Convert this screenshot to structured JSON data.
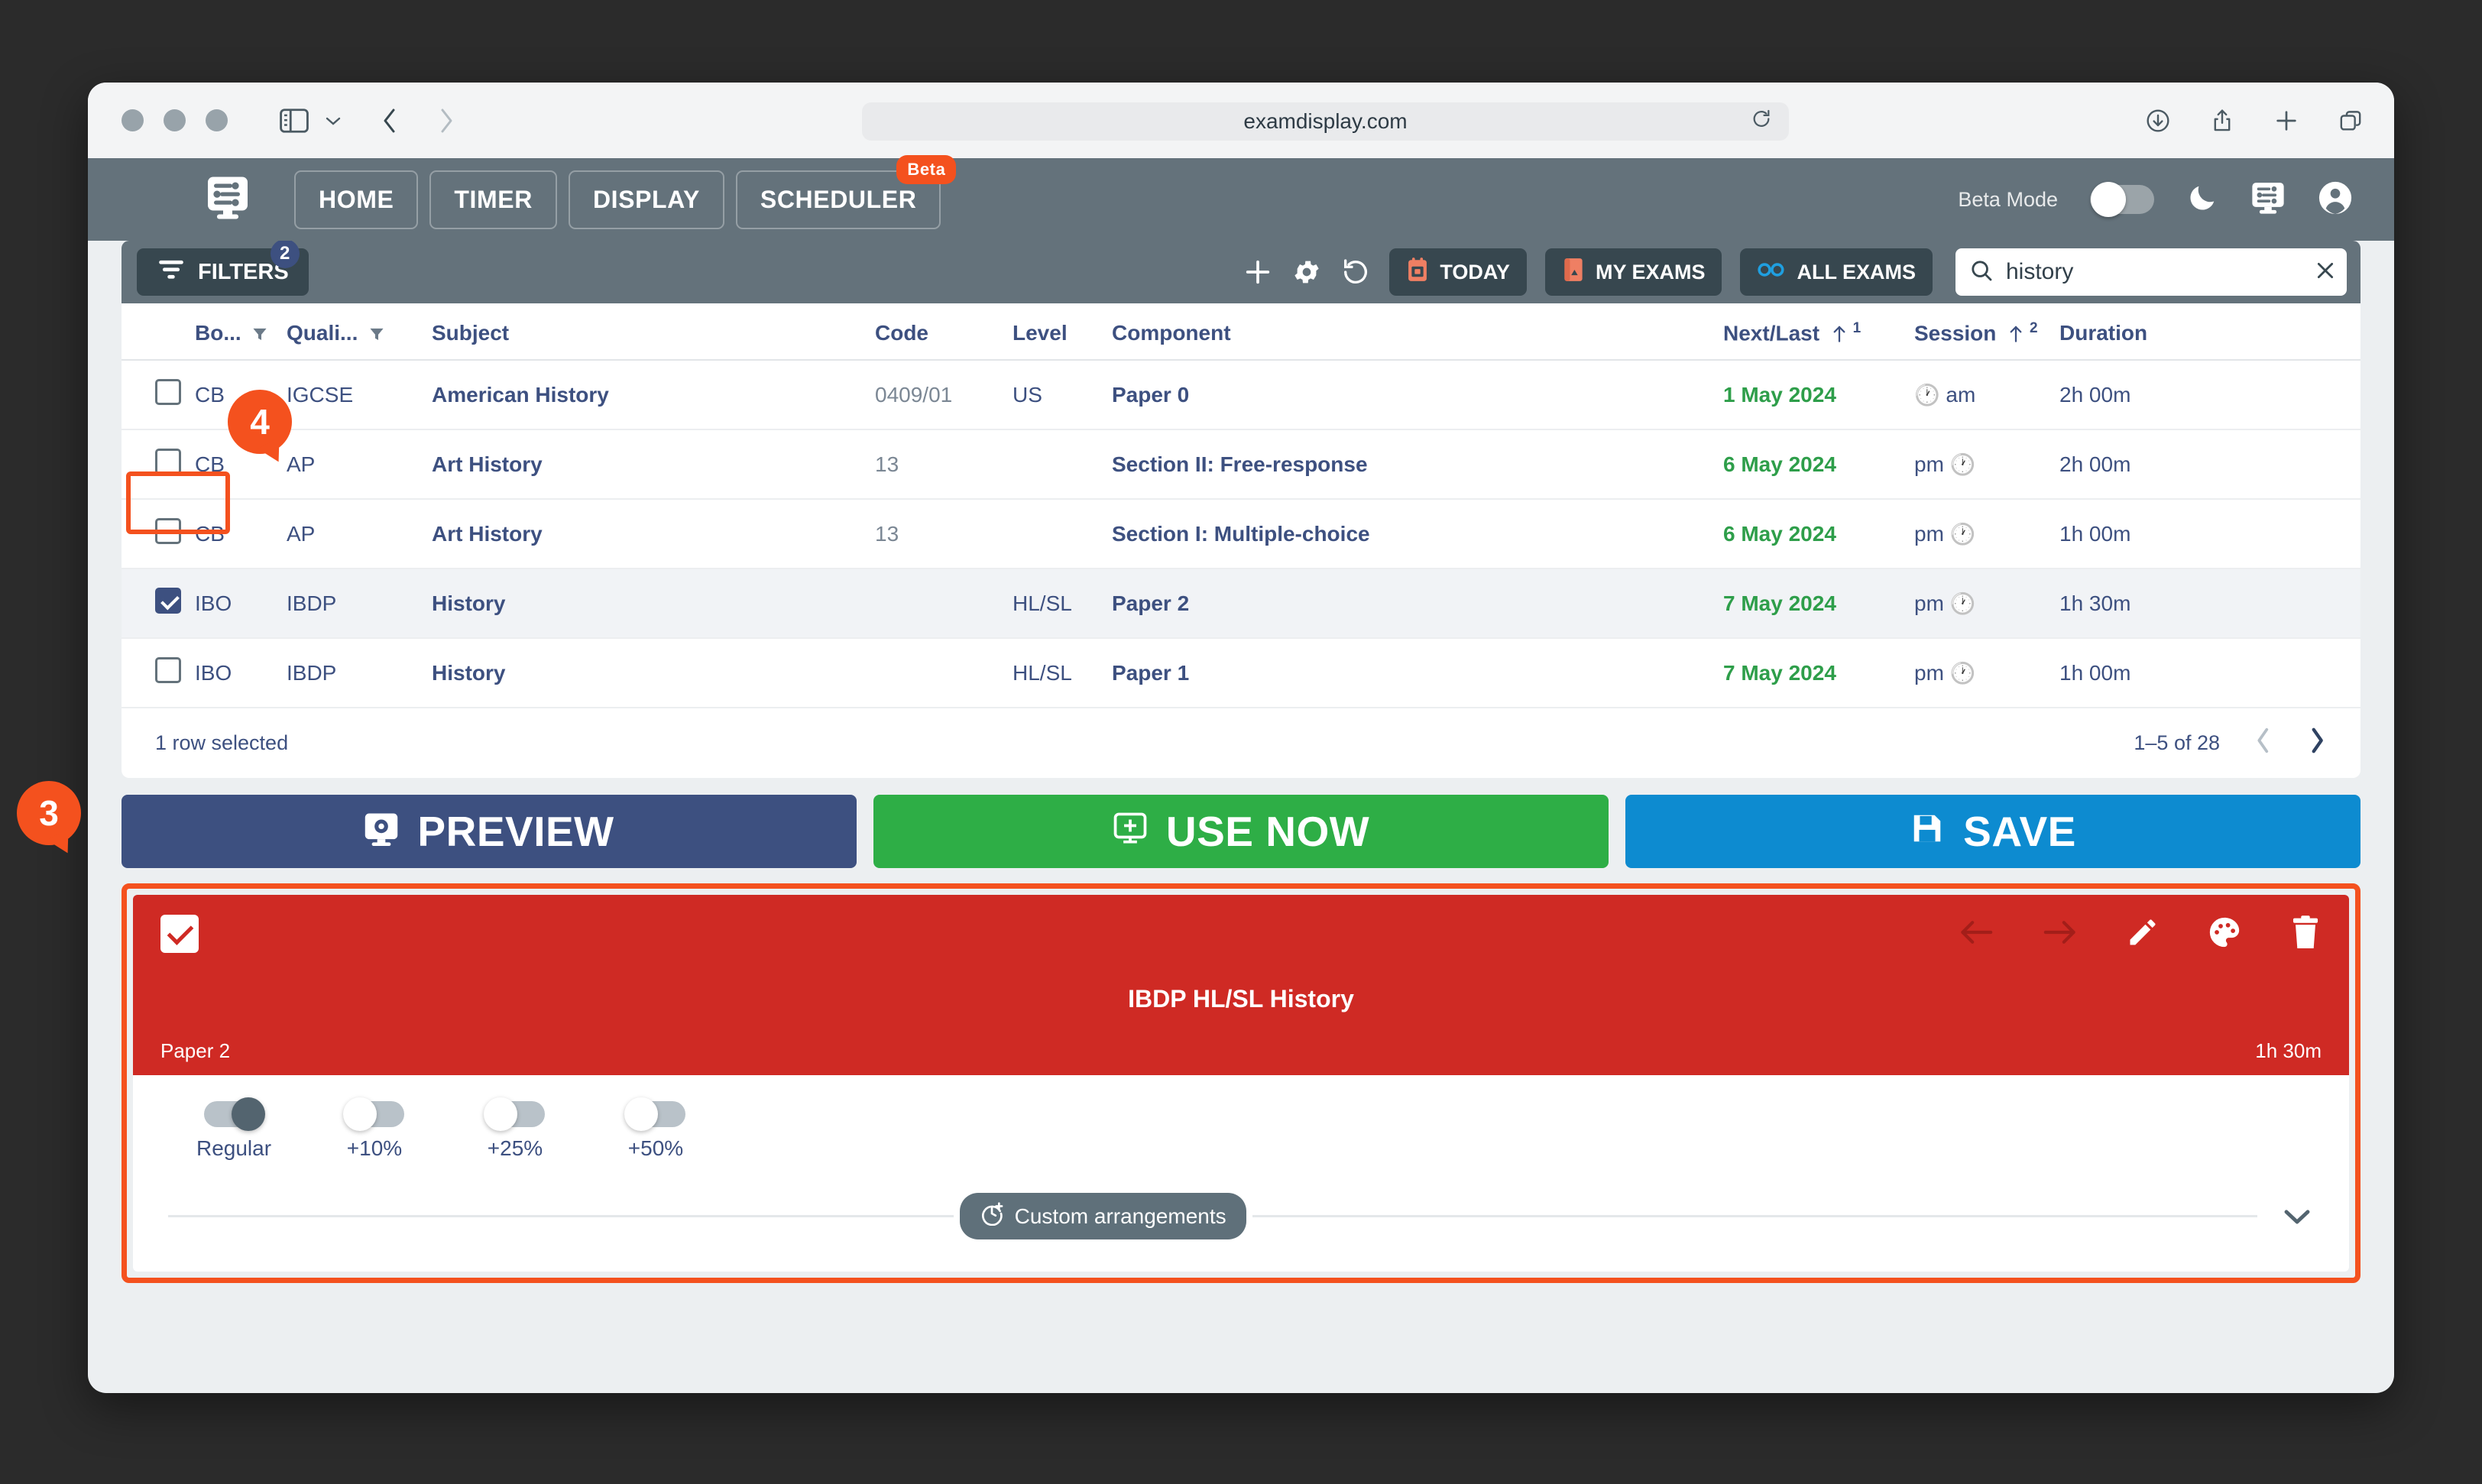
{
  "browser": {
    "url": "examdisplay.com",
    "icons": [
      "sidebar-icon",
      "chevron-down-icon",
      "back-icon",
      "forward-icon",
      "reload-icon",
      "download-icon",
      "share-icon",
      "new-tab-icon",
      "tabs-icon"
    ]
  },
  "nav": {
    "logo": "display-logo-icon",
    "tabs": [
      {
        "label": "HOME",
        "badge": null
      },
      {
        "label": "TIMER",
        "badge": null
      },
      {
        "label": "DISPLAY",
        "badge": null
      },
      {
        "label": "SCHEDULER",
        "badge": "Beta"
      }
    ],
    "beta_mode_label": "Beta Mode",
    "right_icons": [
      "dark-mode-icon",
      "display-icon",
      "account-icon"
    ]
  },
  "toolbar": {
    "filters_label": "FILTERS",
    "filters_count": "2",
    "add_label": "add-icon",
    "settings_label": "settings-icon",
    "refresh_label": "refresh-icon",
    "today_label": "TODAY",
    "my_exams_label": "MY EXAMS",
    "all_exams_label": "ALL EXAMS",
    "search_value": "history",
    "search_placeholder": "Search",
    "clear_label": "clear-icon"
  },
  "table": {
    "headers": {
      "board": "Bo...",
      "qualification": "Quali...",
      "subject": "Subject",
      "code": "Code",
      "level": "Level",
      "component": "Component",
      "next_last": "Next/Last",
      "next_last_sort": "1",
      "session": "Session",
      "session_sort": "2",
      "duration": "Duration"
    },
    "rows": [
      {
        "checked": false,
        "selected": false,
        "board": "CB",
        "qualification": "IGCSE",
        "subject": "American History",
        "code": "0409/01",
        "level": "US",
        "component": "Paper 0",
        "next_last": "1 May 2024",
        "session": "am",
        "session_icon_first": true,
        "duration": "2h 00m"
      },
      {
        "checked": false,
        "selected": false,
        "board": "CB",
        "qualification": "AP",
        "subject": "Art History",
        "code": "13",
        "level": "",
        "component": "Section II: Free-response",
        "next_last": "6 May 2024",
        "session": "pm",
        "session_icon_first": false,
        "duration": "2h 00m"
      },
      {
        "checked": false,
        "selected": false,
        "board": "CB",
        "qualification": "AP",
        "subject": "Art History",
        "code": "13",
        "level": "",
        "component": "Section I: Multiple-choice",
        "next_last": "6 May 2024",
        "session": "pm",
        "session_icon_first": false,
        "duration": "1h 00m"
      },
      {
        "checked": true,
        "selected": true,
        "board": "IBO",
        "qualification": "IBDP",
        "subject": "History",
        "code": "",
        "level": "HL/SL",
        "component": "Paper 2",
        "next_last": "7 May 2024",
        "session": "pm",
        "session_icon_first": false,
        "duration": "1h 30m"
      },
      {
        "checked": false,
        "selected": false,
        "board": "IBO",
        "qualification": "IBDP",
        "subject": "History",
        "code": "",
        "level": "HL/SL",
        "component": "Paper 1",
        "next_last": "7 May 2024",
        "session": "pm",
        "session_icon_first": false,
        "duration": "1h 00m"
      }
    ],
    "footer_selected": "1 row selected",
    "pagination": "1–5 of 28"
  },
  "actions": {
    "preview": "PREVIEW",
    "use_now": "USE NOW",
    "save": "SAVE"
  },
  "card": {
    "title": "IBDP HL/SL History",
    "paper": "Paper 2",
    "duration": "1h 30m",
    "icons": [
      "arrow-left-icon",
      "arrow-right-icon",
      "edit-icon",
      "palette-icon",
      "delete-icon"
    ],
    "toggles": [
      {
        "label": "Regular",
        "on": true
      },
      {
        "label": "+10%",
        "on": false
      },
      {
        "label": "+25%",
        "on": false
      },
      {
        "label": "+50%",
        "on": false
      }
    ],
    "custom_arrangements": "Custom arrangements"
  },
  "annotations": [
    {
      "number": "3"
    },
    {
      "number": "4"
    }
  ],
  "colors": {
    "nav_bg": "#64727b",
    "accent_orange": "#f4511e",
    "preview": "#3d5080",
    "use_now": "#2eae46",
    "save": "#0d8bd0",
    "card_red": "#cf2a24",
    "date_green": "#2e9e4a"
  }
}
